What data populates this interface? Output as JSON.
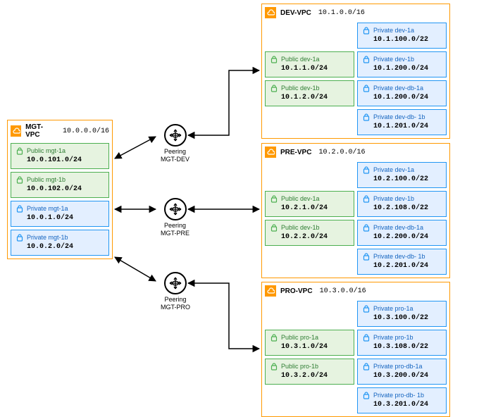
{
  "diagram_type": "aws-vpc-peering",
  "vpcs": {
    "mgt": {
      "name": "MGT-VPC",
      "cidr": "10.0.0.0/16",
      "public": [
        {
          "label": "Public mgt-1a",
          "cidr": "10.0.101.0/24"
        },
        {
          "label": "Public mgt-1b",
          "cidr": "10.0.102.0/24"
        }
      ],
      "private": [
        {
          "label": "Private mgt-1a",
          "cidr": "10.0.1.0/24"
        },
        {
          "label": "Private mgt-1b",
          "cidr": "10.0.2.0/24"
        }
      ]
    },
    "dev": {
      "name": "DEV-VPC",
      "cidr": "10.1.0.0/16",
      "public": [
        {
          "label": "Public dev-1a",
          "cidr": "10.1.1.0/24"
        },
        {
          "label": "Public dev-1b",
          "cidr": "10.1.2.0/24"
        }
      ],
      "private": [
        {
          "label": "Private dev-1a",
          "cidr": "10.1.100.0/22"
        },
        {
          "label": "Private dev-1b",
          "cidr": "10.1.200.0/24"
        },
        {
          "label": "Private dev-db-1a",
          "cidr": "10.1.200.0/24"
        },
        {
          "label": "Private dev-db- 1b",
          "cidr": "10.1.201.0/24"
        }
      ]
    },
    "pre": {
      "name": "PRE-VPC",
      "cidr": "10.2.0.0/16",
      "public": [
        {
          "label": "Public dev-1a",
          "cidr": "10.2.1.0/24"
        },
        {
          "label": "Public dev-1b",
          "cidr": "10.2.2.0/24"
        }
      ],
      "private": [
        {
          "label": "Private dev-1a",
          "cidr": "10.2.100.0/22"
        },
        {
          "label": "Private dev-1b",
          "cidr": "10.2.108.0/22"
        },
        {
          "label": "Private dev-db-1a",
          "cidr": "10.2.200.0/24"
        },
        {
          "label": "Private dev-db- 1b",
          "cidr": "10.2.201.0/24"
        }
      ]
    },
    "pro": {
      "name": "PRO-VPC",
      "cidr": "10.3.0.0/16",
      "public": [
        {
          "label": "Public pro-1a",
          "cidr": "10.3.1.0/24"
        },
        {
          "label": "Public pro-1b",
          "cidr": "10.3.2.0/24"
        }
      ],
      "private": [
        {
          "label": "Private pro-1a",
          "cidr": "10.3.100.0/22"
        },
        {
          "label": "Private pro-1b",
          "cidr": "10.3.108.0/22"
        },
        {
          "label": "Private pro-db-1a",
          "cidr": "10.3.200.0/24"
        },
        {
          "label": "Private pro-db- 1b",
          "cidr": "10.3.201.0/24"
        }
      ]
    }
  },
  "peerings": {
    "mgt_dev": {
      "title": "Peering",
      "name": "MGT-DEV"
    },
    "mgt_pre": {
      "title": "Peering",
      "name": "MGT-PRE"
    },
    "mgt_pro": {
      "title": "Peering",
      "name": "MGT-PRO"
    }
  }
}
